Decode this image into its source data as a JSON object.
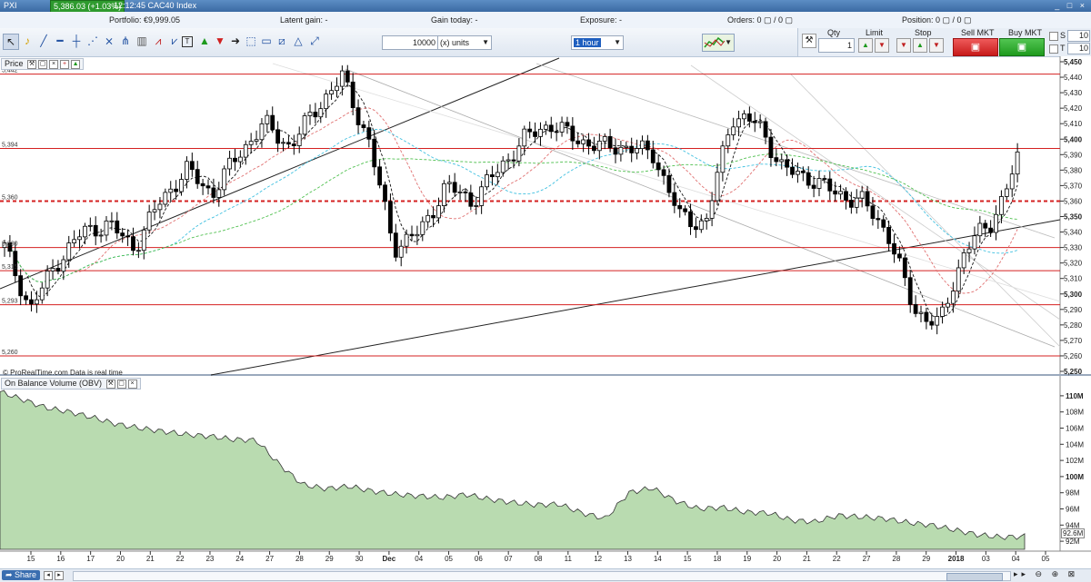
{
  "titlebar": {
    "app": "PXI",
    "price_badge": "5,386.03 (+1.03%)",
    "time_instrument": "12:12:45 CAC40 Index",
    "window_controls": "_ □ ×"
  },
  "topbar": {
    "portfolio": "Portfolio: €9,999.05",
    "latent_gain": "Latent gain: -",
    "gain_today": "Gain today: -",
    "exposure": "Exposure: -",
    "orders": "Orders: 0 ▢ / 0 ▢",
    "position": "Position: 0 ▢ / 0 ▢"
  },
  "toolbar": {
    "quantity_value": "10000",
    "units_label": "(x) units",
    "timeframe": "1 hour",
    "icons": [
      "cursor-icon",
      "bell-icon",
      "line-icon",
      "horizontal-line-icon",
      "fibonacci-icon",
      "gann-icon",
      "pitchfork-icon",
      "trash-icon",
      "zigzag-icon",
      "pattern-icon",
      "text-icon",
      "up-arrow-icon",
      "down-arrow-icon",
      "right-arrow-icon",
      "rectangle-icon",
      "channel-icon",
      "triangle-icon",
      "expand-icon"
    ]
  },
  "trade": {
    "qty_label": "Qty",
    "qty_value": "1",
    "limit_label": "Limit",
    "stop_label": "Stop",
    "sell_label": "Sell MKT",
    "buy_label": "Buy MKT",
    "s_label": "S",
    "s_value": "10",
    "t_label": "T",
    "t_value": "10",
    "colors": {
      "sell": "#d82a2a",
      "buy": "#2ea82e"
    }
  },
  "price_panel": {
    "title": "Price",
    "footer": "© ProRealTime.com Data is real time",
    "level_labels": [
      "5,442",
      "5,394",
      "5,360",
      "5,330",
      "5,315",
      "5,293",
      "5,260"
    ],
    "y_ticks": [
      "5,450",
      "5,440",
      "5,430",
      "5,420",
      "5,410",
      "5,400",
      "5,390",
      "5,380",
      "5,370",
      "5,360",
      "5,350",
      "5,340",
      "5,330",
      "5,320",
      "5,310",
      "5,300",
      "5,290",
      "5,280",
      "5,270",
      "5,260",
      "5,250"
    ],
    "colors": {
      "level_line": "#d42020",
      "up_candle": "#ffffff",
      "down_candle": "#000000"
    }
  },
  "obv_panel": {
    "title": "On Balance Volume (OBV)",
    "y_ticks": [
      "110M",
      "108M",
      "106M",
      "104M",
      "102M",
      "100M",
      "98M",
      "96M",
      "94M",
      "92M"
    ],
    "current_label": "92.6M",
    "fill_color": "#b9dbb0"
  },
  "x_axis": {
    "labels": [
      "15",
      "16",
      "17",
      "20",
      "21",
      "22",
      "23",
      "24",
      "27",
      "28",
      "29",
      "30",
      "Dec",
      "04",
      "05",
      "06",
      "07",
      "08",
      "11",
      "12",
      "13",
      "14",
      "15",
      "18",
      "19",
      "20",
      "21",
      "22",
      "27",
      "28",
      "29",
      "2018",
      "03",
      "04",
      "05"
    ]
  },
  "chart_data": [
    {
      "type": "candlestick",
      "title": "Price",
      "ylim": [
        5250,
        5450
      ],
      "horizontal_levels": [
        5442,
        5394,
        5360,
        5330,
        5315,
        5293,
        5260
      ],
      "last_value": 5386.03,
      "approx_closes": [
        5330,
        5290,
        5320,
        5340,
        5345,
        5330,
        5360,
        5380,
        5365,
        5390,
        5410,
        5395,
        5420,
        5440,
        5400,
        5330,
        5340,
        5370,
        5360,
        5380,
        5400,
        5410,
        5400,
        5395,
        5395,
        5390,
        5350,
        5345,
        5415,
        5410,
        5380,
        5375,
        5365,
        5360,
        5340,
        5290,
        5280,
        5330,
        5346,
        5386
      ]
    },
    {
      "type": "area",
      "title": "On Balance Volume (OBV)",
      "ylim": [
        91,
        111
      ],
      "current": 92.6,
      "approx_values": [
        110.5,
        109.5,
        108.5,
        108,
        107.3,
        106.5,
        106,
        105.6,
        105.2,
        105,
        104.6,
        104.5,
        101.5,
        99,
        98.5,
        98.8,
        98.2,
        97.8,
        97.6,
        97.4,
        97.8,
        97.2,
        96.8,
        96.5,
        96.6,
        95.5,
        94.8,
        98,
        98.6,
        97,
        96,
        96.2,
        95.6,
        95.5,
        94.6,
        94.4,
        95.2,
        95,
        94.8,
        94.3,
        94,
        93.4,
        92.8,
        92.5,
        92.6
      ]
    }
  ]
}
